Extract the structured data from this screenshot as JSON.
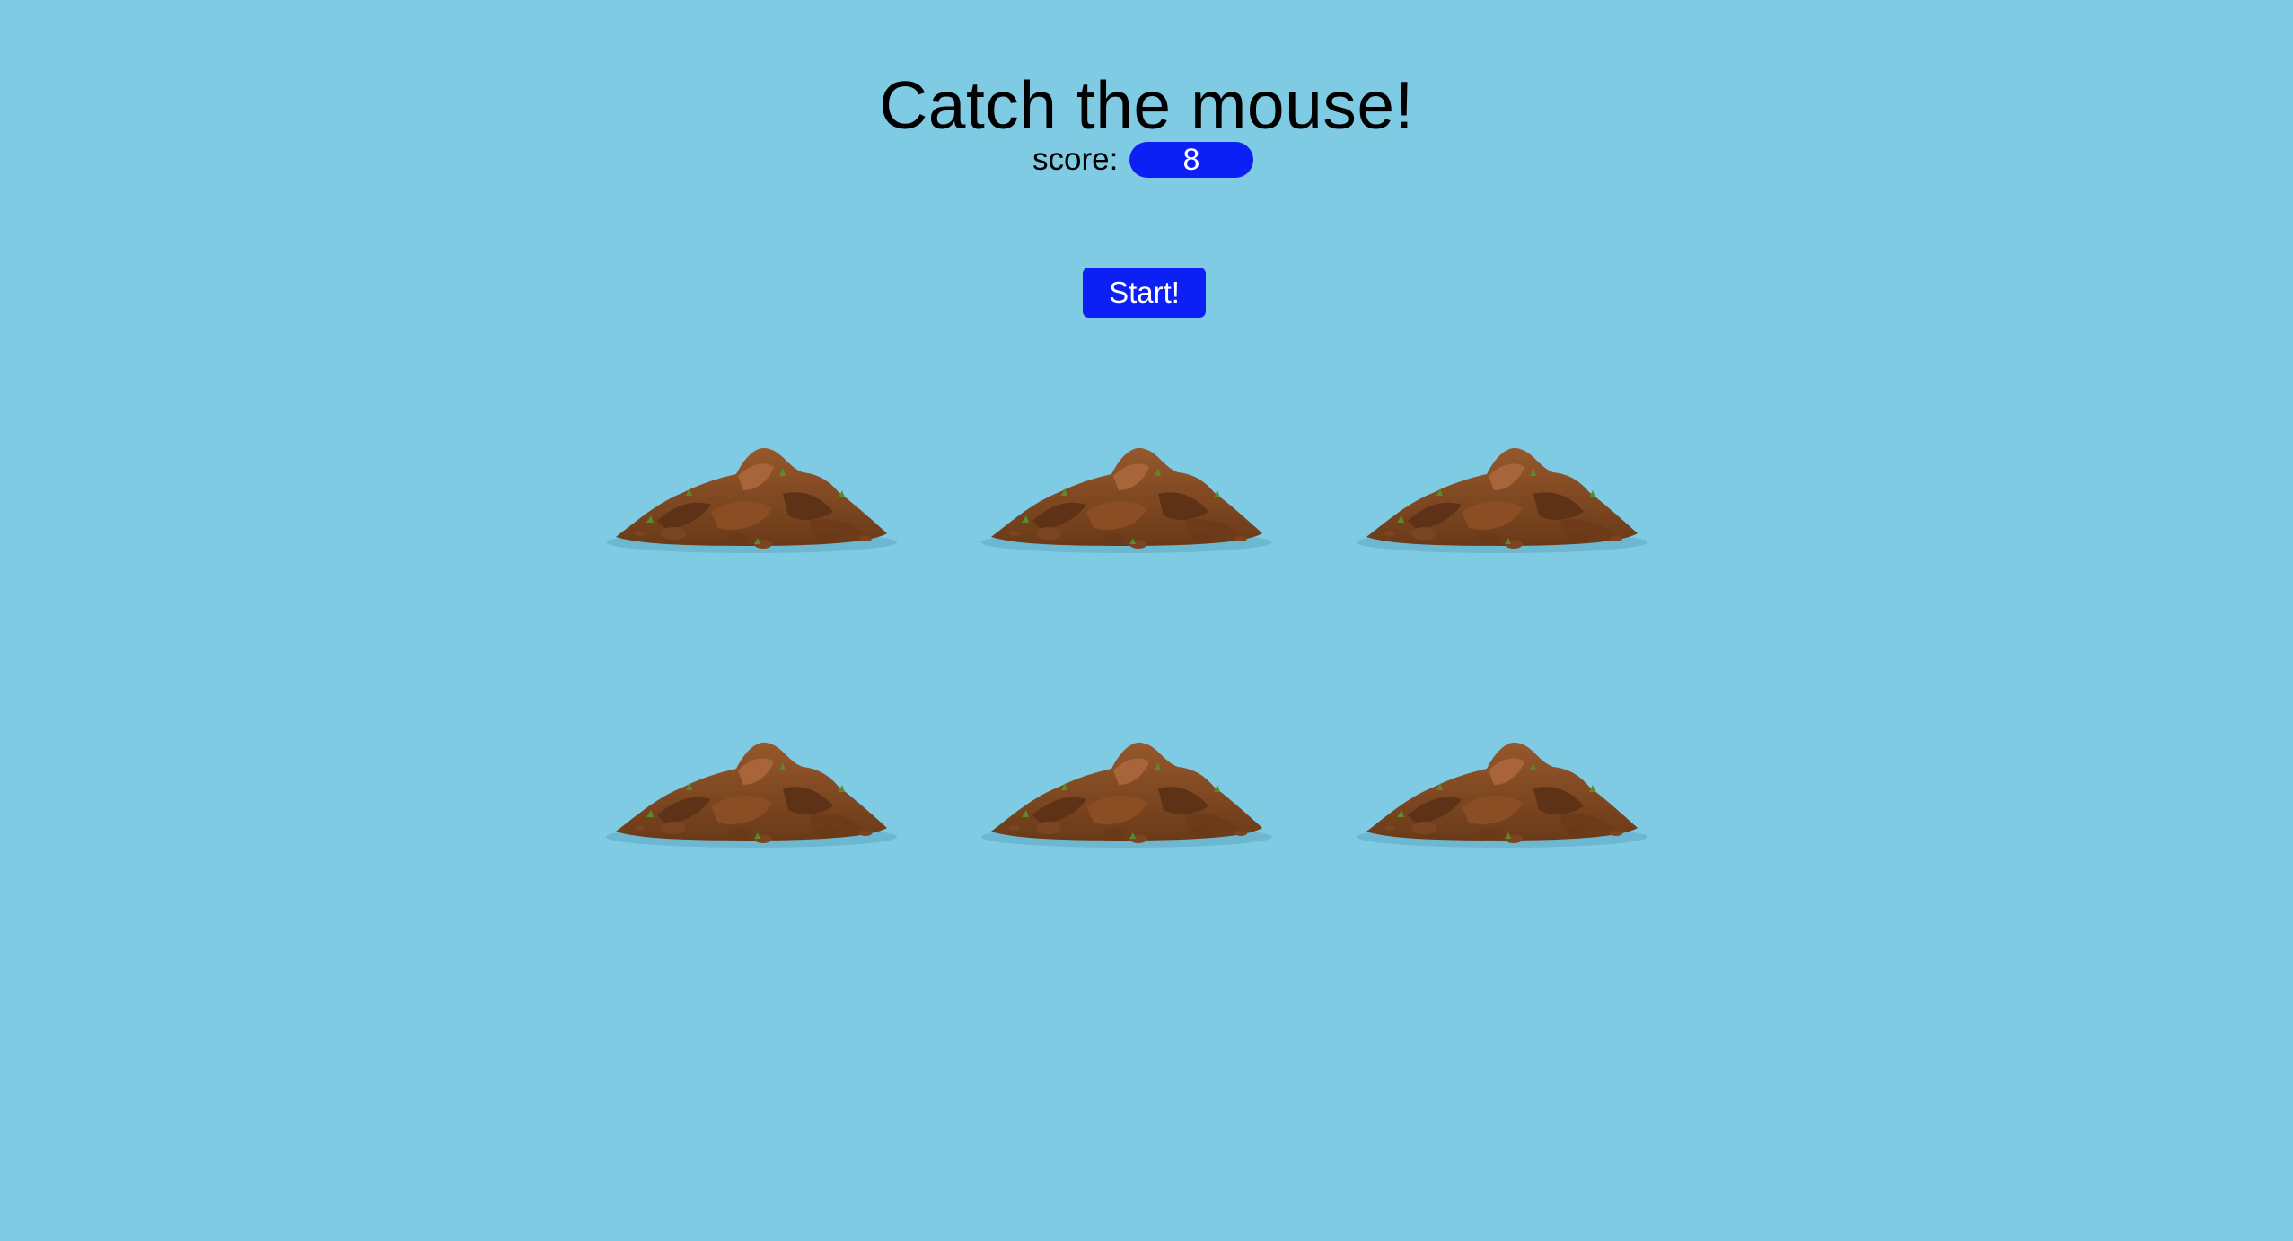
{
  "game": {
    "title": "Catch the mouse!",
    "score_label": "score:",
    "score_value": "8",
    "start_label": "Start!"
  },
  "board": {
    "holes": [
      {
        "name": "hole-1",
        "icon": "dirt-mound-icon"
      },
      {
        "name": "hole-2",
        "icon": "dirt-mound-icon"
      },
      {
        "name": "hole-3",
        "icon": "dirt-mound-icon"
      },
      {
        "name": "hole-4",
        "icon": "dirt-mound-icon"
      },
      {
        "name": "hole-5",
        "icon": "dirt-mound-icon"
      },
      {
        "name": "hole-6",
        "icon": "dirt-mound-icon"
      }
    ]
  },
  "colors": {
    "background": "#7fcbe4",
    "accent": "#0c1ff5",
    "dirt": "#7a4520",
    "grass": "#5a8a2a"
  }
}
